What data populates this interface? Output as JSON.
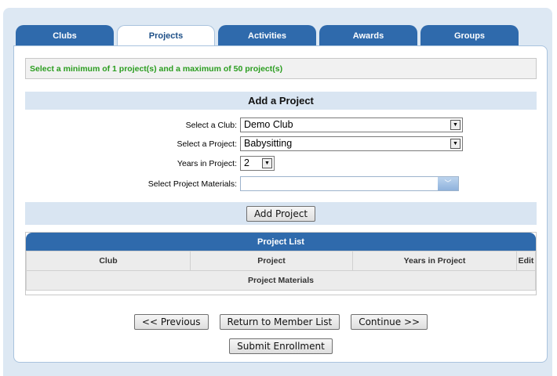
{
  "tabs": [
    {
      "label": "Clubs",
      "active": false
    },
    {
      "label": "Projects",
      "active": true
    },
    {
      "label": "Activities",
      "active": false
    },
    {
      "label": "Awards",
      "active": false
    },
    {
      "label": "Groups",
      "active": false
    }
  ],
  "notice": "Select a minimum of 1 project(s) and a maximum of 50 project(s)",
  "add_project": {
    "heading": "Add a Project",
    "club_label": "Select a Club:",
    "club_value": "Demo Club",
    "project_label": "Select a Project:",
    "project_value": "Babysitting",
    "years_label": "Years in Project:",
    "years_value": "2",
    "materials_label": "Select Project Materials:",
    "materials_value": "",
    "add_button": "Add Project"
  },
  "project_list": {
    "title": "Project List",
    "columns": [
      "Club",
      "Project",
      "Years in Project",
      "Edit"
    ],
    "materials_header": "Project Materials"
  },
  "nav": {
    "previous": "<< Previous",
    "return": "Return to Member List",
    "continue": "Continue >>",
    "submit": "Submit Enrollment"
  },
  "colors": {
    "tab_blue": "#2f6aac",
    "notice_green": "#2a9d1f",
    "section_bg": "#d9e5f2"
  }
}
